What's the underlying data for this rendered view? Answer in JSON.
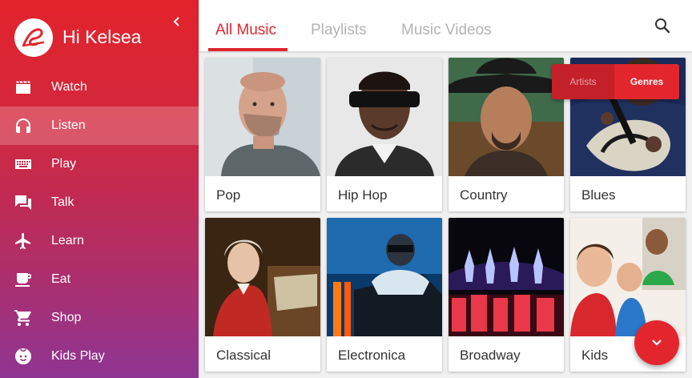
{
  "sidebar": {
    "greeting": "Hi Kelsea",
    "logo_icon": "virgin-logo",
    "collapse_icon": "chevron-left-icon",
    "items": [
      {
        "label": "Watch",
        "icon": "movie-icon"
      },
      {
        "label": "Listen",
        "icon": "headphones-icon",
        "active": true
      },
      {
        "label": "Play",
        "icon": "keyboard-icon"
      },
      {
        "label": "Talk",
        "icon": "chat-icon"
      },
      {
        "label": "Learn",
        "icon": "airplane-icon"
      },
      {
        "label": "Eat",
        "icon": "coffee-icon"
      },
      {
        "label": "Shop",
        "icon": "cart-icon"
      },
      {
        "label": "Kids Play",
        "icon": "child-face-icon"
      }
    ]
  },
  "tabs": [
    {
      "label": "All Music",
      "active": true
    },
    {
      "label": "Playlists"
    },
    {
      "label": "Music Videos"
    }
  ],
  "search_icon": "search-icon",
  "toggle": {
    "artists": "Artists",
    "genres": "Genres",
    "selected": "Genres"
  },
  "genres": [
    {
      "label": "Pop"
    },
    {
      "label": "Hip Hop"
    },
    {
      "label": "Country"
    },
    {
      "label": "Blues"
    },
    {
      "label": "Classical"
    },
    {
      "label": "Electronica"
    },
    {
      "label": "Broadway"
    },
    {
      "label": "Kids"
    }
  ],
  "fab_icon": "chevron-down-icon",
  "colors": {
    "accent": "#e3262e",
    "sidebar_top": "#e3232b",
    "sidebar_bottom": "#8e3593"
  }
}
